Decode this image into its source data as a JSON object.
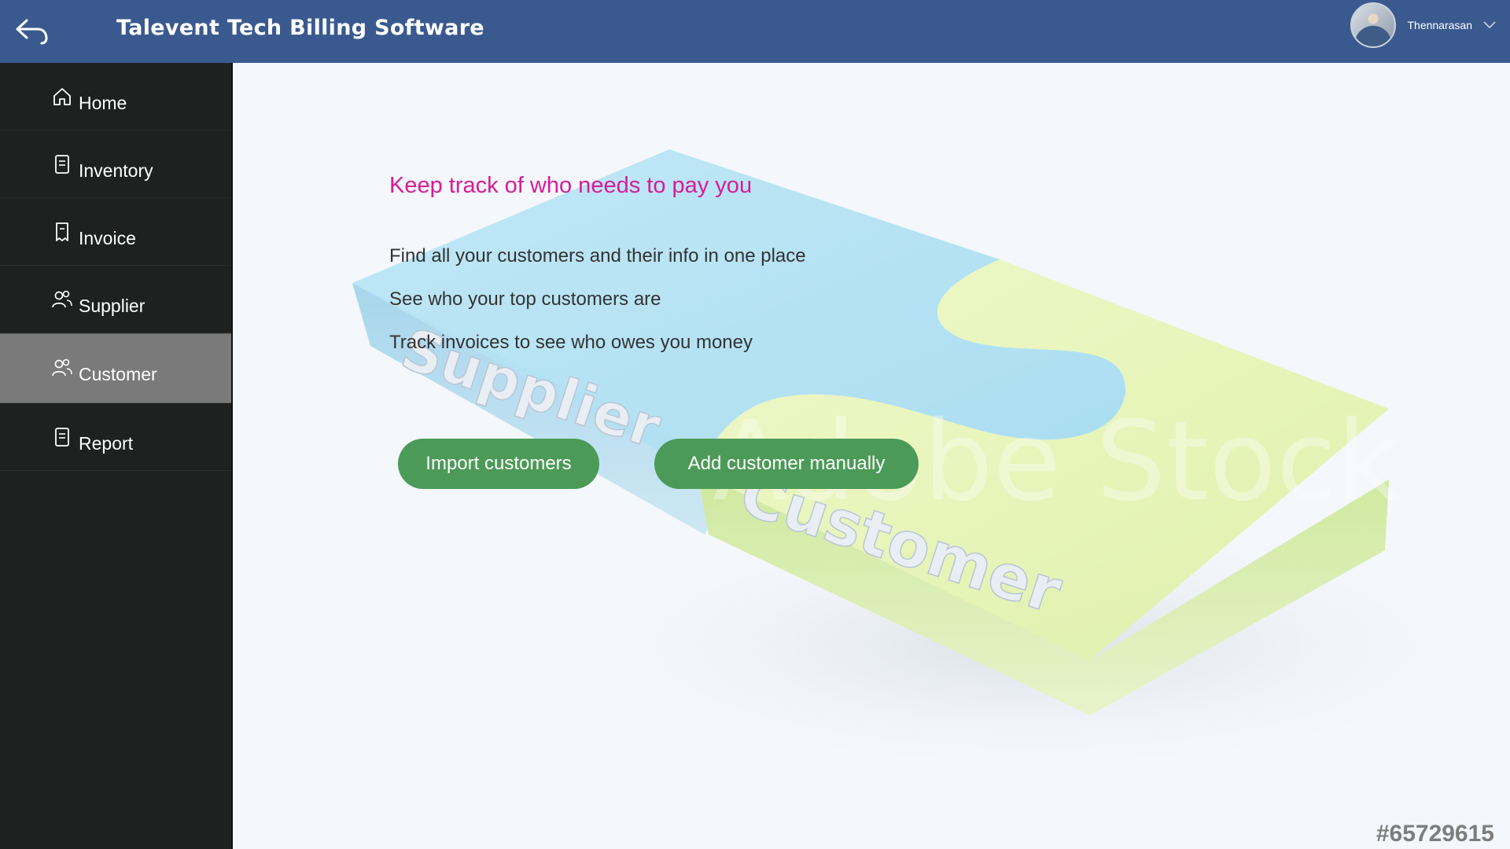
{
  "header": {
    "title": "Talevent Tech Billing Software",
    "user_name": "Thennarasan",
    "bg_color": "#3a5a8f"
  },
  "sidebar": {
    "items": [
      {
        "label": "Home",
        "icon": "home-icon"
      },
      {
        "label": "Inventory",
        "icon": "document-icon"
      },
      {
        "label": "Invoice",
        "icon": "receipt-icon"
      },
      {
        "label": "Supplier",
        "icon": "people-icon"
      },
      {
        "label": "Customer",
        "icon": "people-icon",
        "active": true
      },
      {
        "label": "Report",
        "icon": "document-icon"
      }
    ]
  },
  "main": {
    "heading": "Keep track of who needs to pay you",
    "features": [
      "Find all your customers and their info in one place",
      "See who your top customers are",
      "Track invoices to see who owes you money"
    ],
    "buttons": {
      "import": "Import customers",
      "add_manual": "Add customer manually"
    },
    "art_labels": {
      "supplier": "Supplier",
      "customer": "Customer",
      "stock_watermark": "Adobe Stock"
    },
    "image_id": "#65729615",
    "heading_color": "#d81b9a",
    "button_color": "#4c9a57"
  }
}
